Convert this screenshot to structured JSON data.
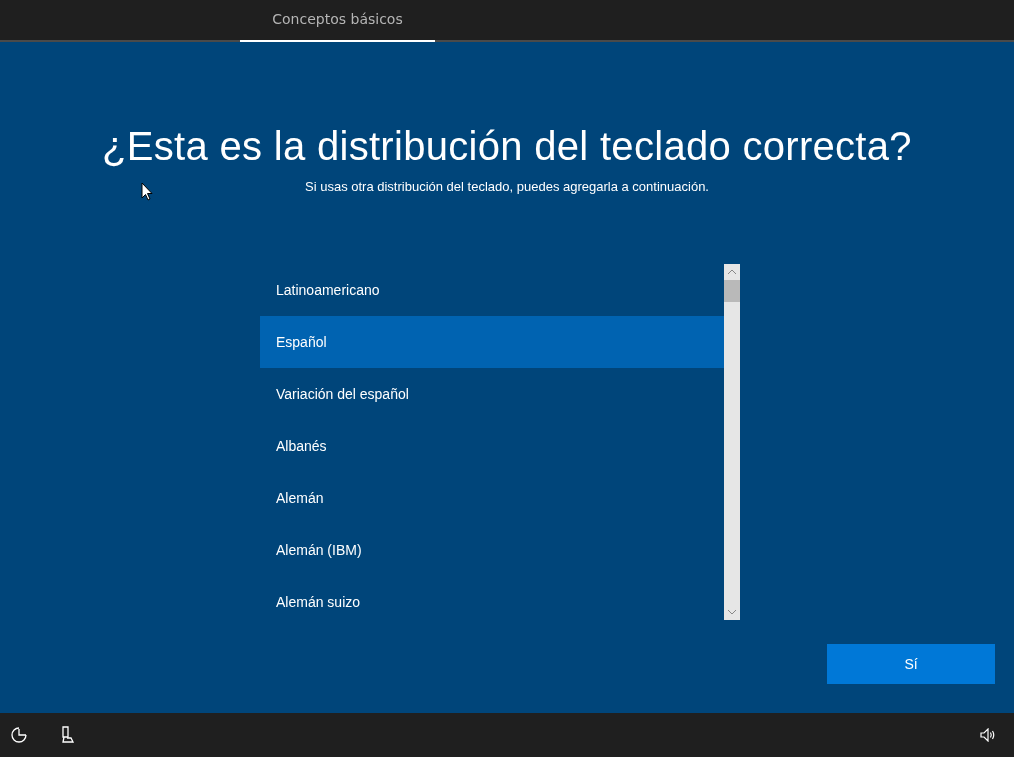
{
  "tabs": [
    {
      "label": "Conceptos básicos",
      "selected": true
    }
  ],
  "title": "¿Esta es la distribución del teclado correcta?",
  "subtitle": "Si usas otra distribución del teclado, puedes agregarla a continuación.",
  "layouts": [
    {
      "label": "Latinoamericano",
      "selected": false
    },
    {
      "label": "Español",
      "selected": true
    },
    {
      "label": "Variación del español",
      "selected": false
    },
    {
      "label": "Albanés",
      "selected": false
    },
    {
      "label": "Alemán",
      "selected": false
    },
    {
      "label": "Alemán (IBM)",
      "selected": false
    },
    {
      "label": "Alemán suizo",
      "selected": false
    }
  ],
  "confirm_button": "Sí"
}
